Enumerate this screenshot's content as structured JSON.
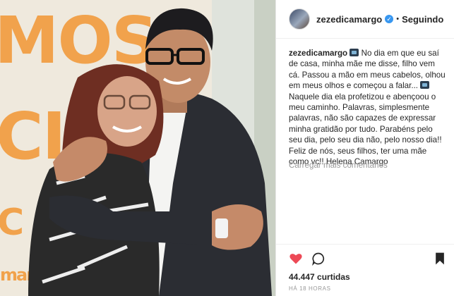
{
  "post": {
    "author": {
      "username": "zezedicamargo",
      "verified": true,
      "follow_state": "Seguindo",
      "separator": "•"
    },
    "photo": {
      "background_text": [
        "MOS",
        "CIS",
        "C",
        "margo"
      ]
    },
    "caption": {
      "username": "zezedicamargo",
      "emoji_icon": "calendar-emoji-icon",
      "part1": "No dia em que eu saí de casa, minha mãe me disse, filho vem cá. Passou a mão em meus cabelos, olhou em meus olhos e começou a falar...",
      "part2": "Naquele dia ela profetizou e abençoou o meu caminho. Palavras, simplesmente palavras, não são capazes de expressar minha gratidão por tudo. Parabéns pelo seu dia, pelo seu dia não, pelo nosso dia!! Feliz de nós, seus filhos, ter uma mãe como vc!! Helena Camargo"
    },
    "load_more_comments": "Carregar mais comentários",
    "actions": {
      "like_icon": "heart-icon",
      "comment_icon": "comment-icon",
      "save_icon": "bookmark-icon"
    },
    "likes": "44.447 curtidas",
    "time_ago": "HÁ 18 HORAS"
  },
  "colors": {
    "heart": "#ed4956",
    "verified": "#3897f0",
    "muted": "#999999",
    "background_banner": "#f1a24c"
  }
}
